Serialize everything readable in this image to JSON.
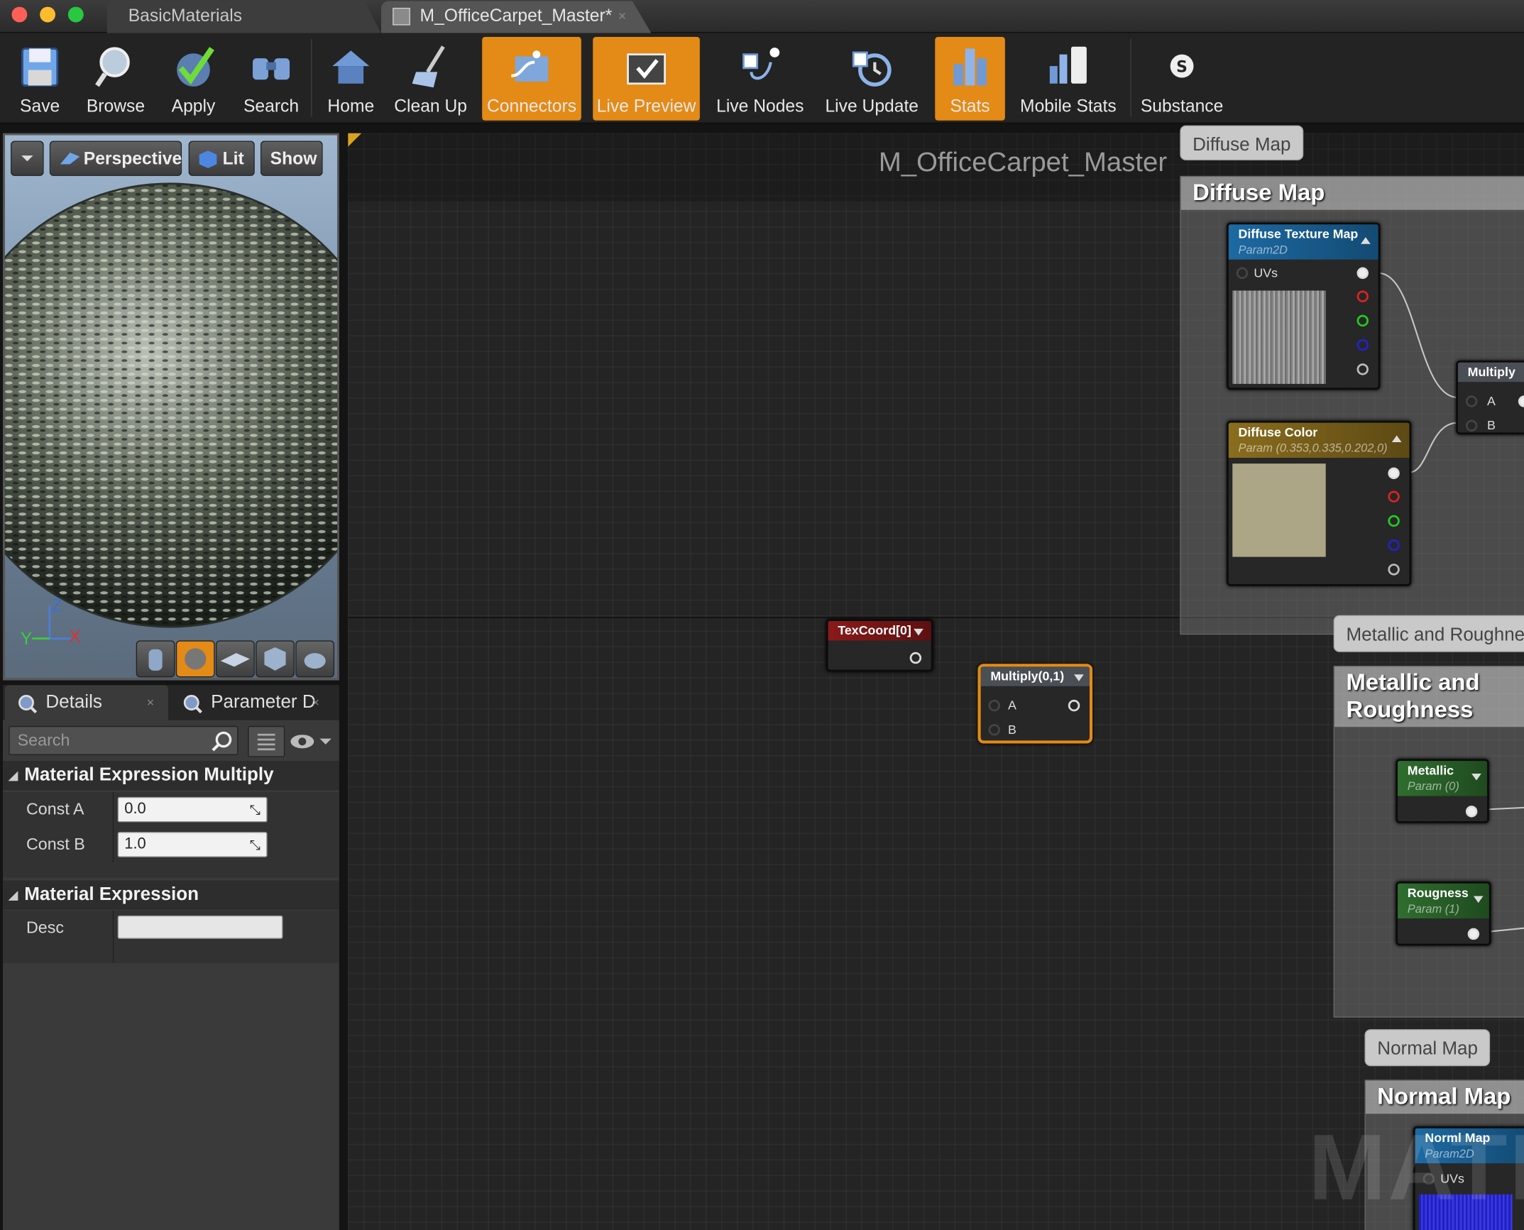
{
  "window": {
    "tabs": [
      {
        "label": "BasicMaterials"
      },
      {
        "label": "M_OfficeCarpet_Master*",
        "close": "×"
      }
    ]
  },
  "toolbar": {
    "items": [
      {
        "label": "Save",
        "icon": "save-icon",
        "active": false
      },
      {
        "label": "Browse",
        "icon": "browse-icon",
        "active": false
      },
      {
        "label": "Apply",
        "icon": "apply-icon",
        "active": false
      },
      {
        "label": "Search",
        "icon": "search-icon",
        "active": false
      },
      {
        "label": "Home",
        "icon": "home-icon",
        "active": false
      },
      {
        "label": "Clean Up",
        "icon": "clean-up-icon",
        "active": false
      },
      {
        "label": "Connectors",
        "icon": "connectors-icon",
        "active": true
      },
      {
        "label": "Live Preview",
        "icon": "live-preview-icon",
        "active": true
      },
      {
        "label": "Live Nodes",
        "icon": "live-nodes-icon",
        "active": false
      },
      {
        "label": "Live Update",
        "icon": "live-update-icon",
        "active": false
      },
      {
        "label": "Stats",
        "icon": "stats-icon",
        "active": true
      },
      {
        "label": "Mobile Stats",
        "icon": "mobile-stats-icon",
        "active": false
      },
      {
        "label": "Substance",
        "icon": "substance-icon",
        "active": false
      }
    ],
    "accent": "#e48a16"
  },
  "viewport": {
    "perspective": "Perspective",
    "lit": "Lit",
    "show": "Show",
    "axis_z": "Z",
    "axis_y": "Y",
    "axis_x": "X"
  },
  "details": {
    "tab_details": "Details",
    "tab_params": "Parameter D",
    "close": "×",
    "search_placeholder": "Search",
    "section1": "Material Expression Multiply",
    "const_a_label": "Const A",
    "const_a_value": "0.0",
    "const_b_label": "Const B",
    "const_b_value": "1.0",
    "section2": "Material Expression",
    "desc_label": "Desc",
    "desc_value": ""
  },
  "graph": {
    "title": "M_OfficeCarpet_Master",
    "watermark": "MATE",
    "comments": {
      "diffuse": "Diffuse Map",
      "metallic": "Metallic and Roughness",
      "metallic_bubble": "Metallic and Roughnes",
      "normal": "Normal Map"
    },
    "nodes": {
      "texcoord": {
        "title": "TexCoord[0]"
      },
      "multiply01": {
        "title": "Multiply(0,1)",
        "a": "A",
        "b": "B"
      },
      "diffuse_tex": {
        "title": "Diffuse Texture Map",
        "sub": "Param2D",
        "uvs": "UVs"
      },
      "diffuse_color": {
        "title": "Diffuse Color",
        "sub": "Param (0.353,0.335,0.202,0)",
        "swatch": "#aca586"
      },
      "multiply": {
        "title": "Multiply",
        "a": "A",
        "b": "B"
      },
      "metallic": {
        "title": "Metallic",
        "sub": "Param (0)"
      },
      "roughness": {
        "title": "Rougness",
        "sub": "Param (1)"
      },
      "normal": {
        "title": "Norml Map",
        "sub": "Param2D",
        "uvs": "UVs"
      }
    }
  }
}
